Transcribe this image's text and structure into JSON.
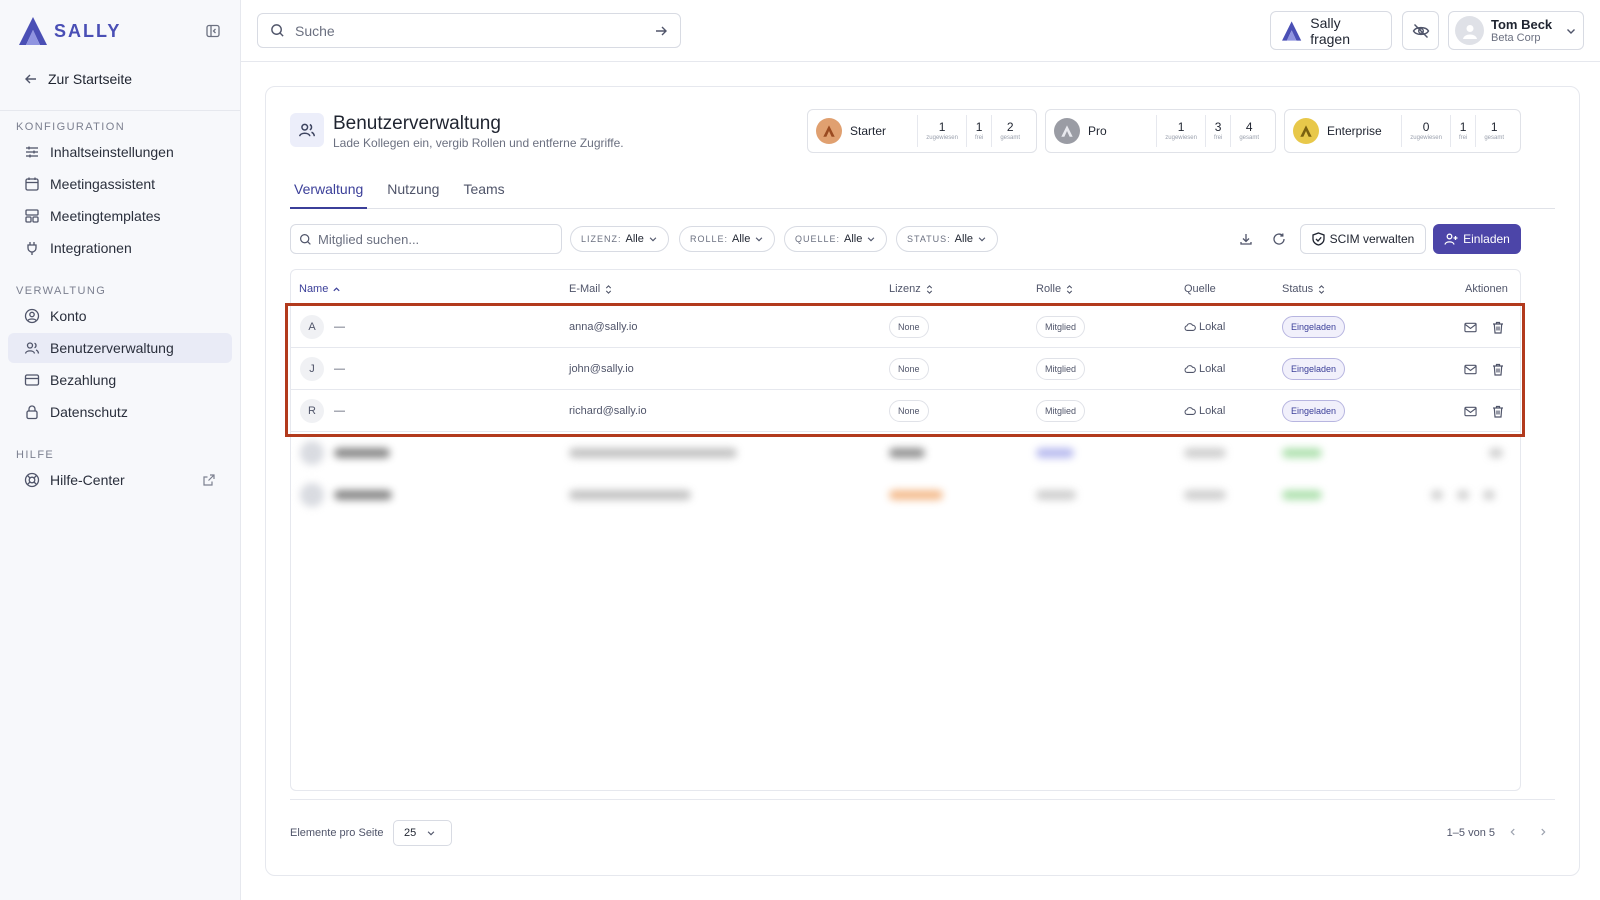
{
  "brand": {
    "name": "SALLY",
    "accent": "#4a4fb5"
  },
  "sidebar": {
    "back_label": "Zur Startseite",
    "sections": [
      {
        "title": "KONFIGURATION",
        "items": [
          "Inhaltseinstellungen",
          "Meetingassistent",
          "Meetingtemplates",
          "Integrationen"
        ]
      },
      {
        "title": "VERWALTUNG",
        "items": [
          "Konto",
          "Benutzerverwaltung",
          "Bezahlung",
          "Datenschutz"
        ]
      },
      {
        "title": "HILFE",
        "items": [
          "Hilfe-Center"
        ]
      }
    ],
    "active_item": "Benutzerverwaltung"
  },
  "topbar": {
    "search_placeholder": "Suche",
    "ask_label": "Sally fragen",
    "user": {
      "name": "Tom Beck",
      "org": "Beta Corp"
    }
  },
  "page": {
    "title": "Benutzerverwaltung",
    "subtitle": "Lade Kollegen ein, vergib Rollen und entferne Zugriffe."
  },
  "licenses": [
    {
      "name": "Starter",
      "assigned": "1",
      "free": "1",
      "total": "2",
      "color": "#e0a070"
    },
    {
      "name": "Pro",
      "assigned": "1",
      "free": "3",
      "total": "4",
      "color": "#9a9ca4"
    },
    {
      "name": "Enterprise",
      "assigned": "0",
      "free": "1",
      "total": "1",
      "color": "#e8c84a"
    }
  ],
  "license_labels": {
    "assigned": "zugewiesen",
    "free": "frei",
    "total": "gesamt"
  },
  "tabs": [
    "Verwaltung",
    "Nutzung",
    "Teams"
  ],
  "filters": {
    "search_placeholder": "Mitglied suchen...",
    "chips": [
      {
        "key": "LIZENZ:",
        "value": "Alle"
      },
      {
        "key": "ROLLE:",
        "value": "Alle"
      },
      {
        "key": "QUELLE:",
        "value": "Alle"
      },
      {
        "key": "STATUS:",
        "value": "Alle"
      }
    ],
    "scim_label": "SCIM verwalten",
    "invite_label": "Einladen"
  },
  "table": {
    "headers": [
      "Name",
      "E-Mail",
      "Lizenz",
      "Rolle",
      "Quelle",
      "Status",
      "Aktionen"
    ],
    "rows": [
      {
        "initial": "A",
        "name": "—",
        "email": "anna@sally.io",
        "license": "None",
        "role": "Mitglied",
        "source": "Lokal",
        "status": "Eingeladen"
      },
      {
        "initial": "J",
        "name": "—",
        "email": "john@sally.io",
        "license": "None",
        "role": "Mitglied",
        "source": "Lokal",
        "status": "Eingeladen"
      },
      {
        "initial": "R",
        "name": "—",
        "email": "richard@sally.io",
        "license": "None",
        "role": "Mitglied",
        "source": "Lokal",
        "status": "Eingeladen"
      }
    ]
  },
  "pagination": {
    "per_page_label": "Elemente pro Seite",
    "per_page_value": "25",
    "range": "1–5 von 5"
  }
}
